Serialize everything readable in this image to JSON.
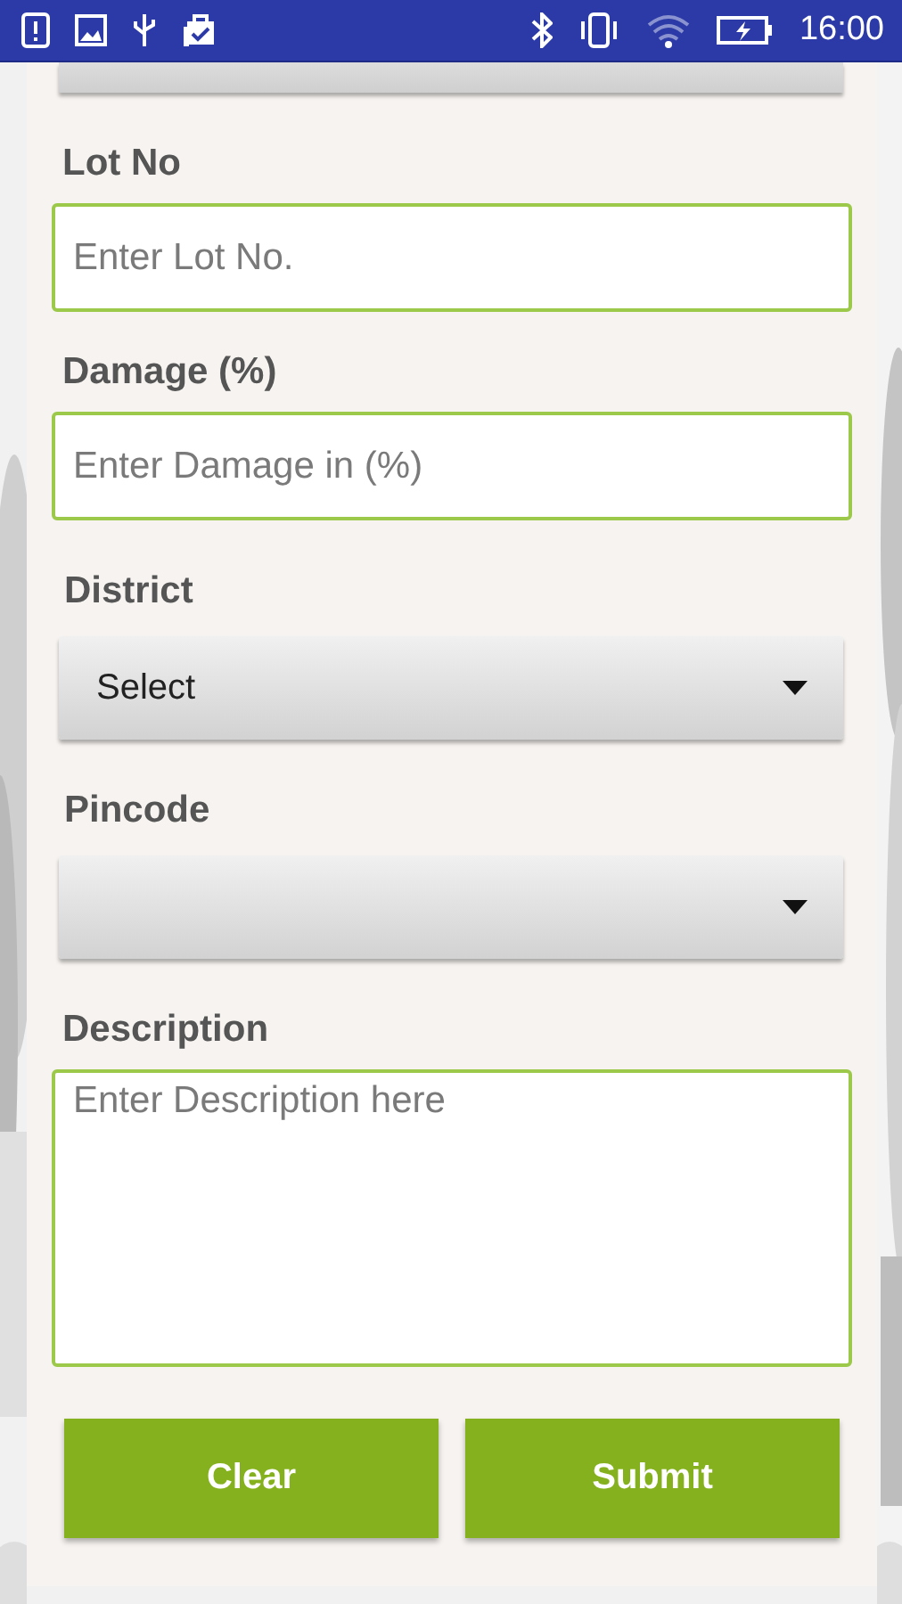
{
  "status_bar": {
    "time": "16:00"
  },
  "fields": [
    {
      "kind": "text",
      "label": "Lot No",
      "placeholder": "Enter Lot No."
    },
    {
      "kind": "text",
      "label": "Damage (%)",
      "placeholder": "Enter Damage in (%)"
    },
    {
      "kind": "select",
      "label": "District",
      "value": "Select"
    },
    {
      "kind": "select",
      "label": "Pincode"
    },
    {
      "kind": "textarea",
      "label": "Description",
      "placeholder": "Enter Description here"
    }
  ],
  "buttons": [
    {
      "label": "Clear"
    },
    {
      "label": "Submit"
    }
  ]
}
